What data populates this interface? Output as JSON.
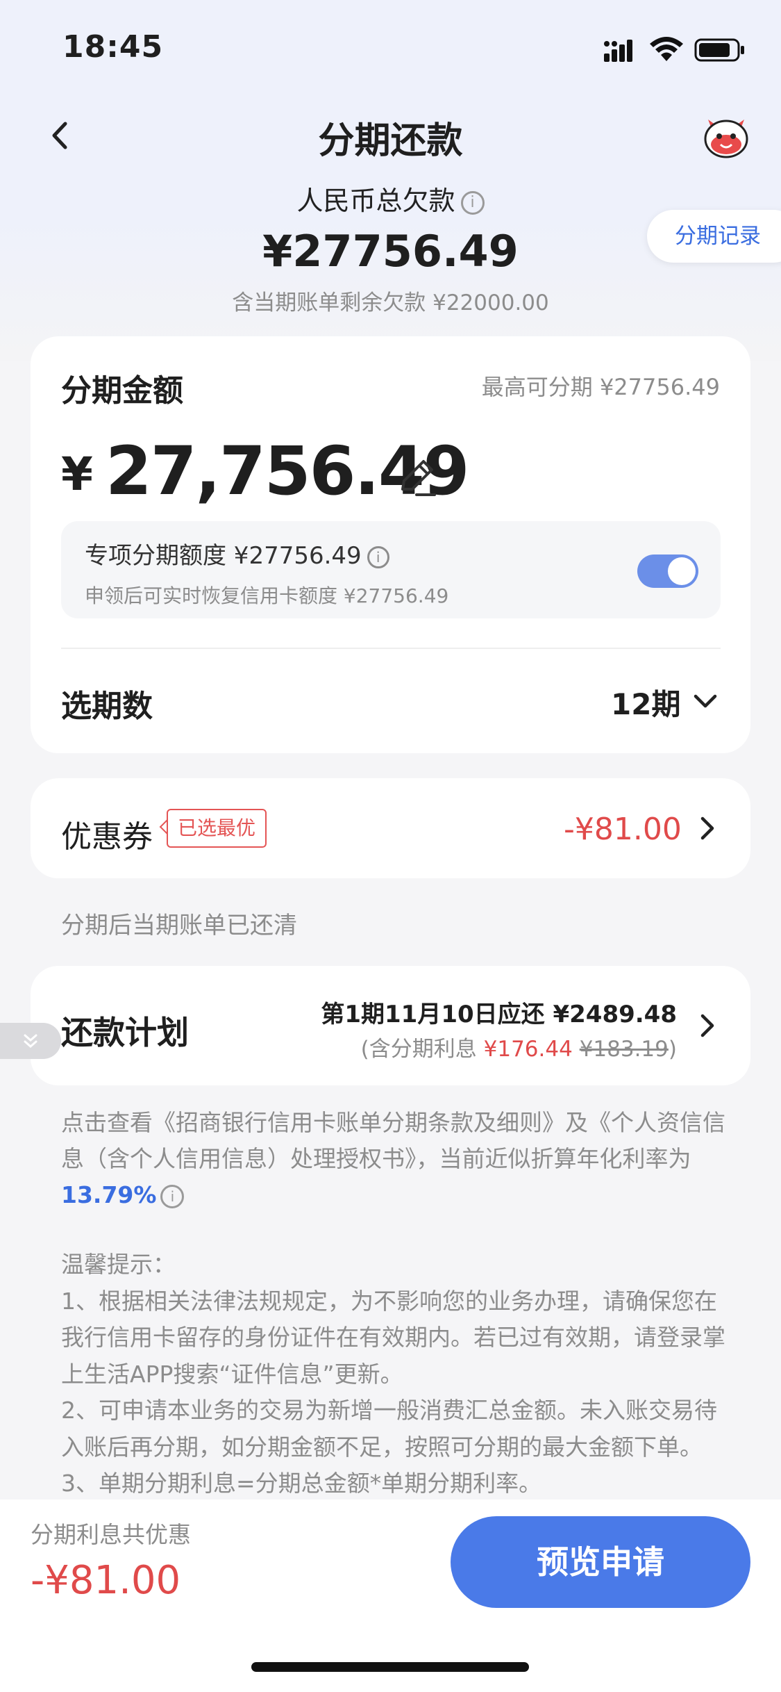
{
  "status_bar": {
    "time": "18:45"
  },
  "nav": {
    "title": "分期还款"
  },
  "debt": {
    "label": "人民币总欠款",
    "amount": "¥27756.49",
    "sub": "含当期账单剩余欠款 ¥22000.00"
  },
  "record_button": "分期记录",
  "amount_card": {
    "title": "分期金额",
    "max": "最高可分期 ¥27756.49",
    "yen": "¥",
    "amount": "27,756.49",
    "quota_title": "专项分期额度 ¥27756.49",
    "quota_desc": "申领后可实时恢复信用卡额度 ¥27756.49",
    "quota_enabled": true,
    "period_label": "选期数",
    "period_value": "12期"
  },
  "coupon": {
    "label": "优惠券",
    "tag": "已选最优",
    "value": "-¥81.00"
  },
  "note_paid": "分期后当期账单已还清",
  "plan": {
    "label": "还款计划",
    "line1": "第1期11月10日应还 ¥2489.48",
    "line2_prefix": "(含分期利息 ",
    "interest": "¥176.44",
    "original": "¥183.19",
    "line2_suffix": ")"
  },
  "legal": {
    "text": "点击查看《招商银行信用卡账单分期条款及细则》及《个人资信信息（含个人信用信息）处理授权书》，当前近似折算年化利率为",
    "rate": "13.79%"
  },
  "tips": {
    "title": "温馨提示：",
    "items": [
      "1、根据相关法律法规规定，为不影响您的业务办理，请确保您在我行信用卡留存的身份证件在有效期内。若已过有效期，请登录掌上生活APP搜索“证件信息”更新。",
      "2、可申请本业务的交易为新增一般消费汇总金额。未入账交易待入账后再分期，如分期金额不足，按照可分期的最大金额下单。",
      "3、单期分期利息=分期总金额*单期分期利率。"
    ]
  },
  "footer": {
    "discount_label": "分期利息共优惠",
    "discount_value": "-¥81.00",
    "submit": "预览申请"
  },
  "colors": {
    "accent": "#4a7ae8",
    "red": "#e04a4a",
    "link": "#3a6de0"
  }
}
